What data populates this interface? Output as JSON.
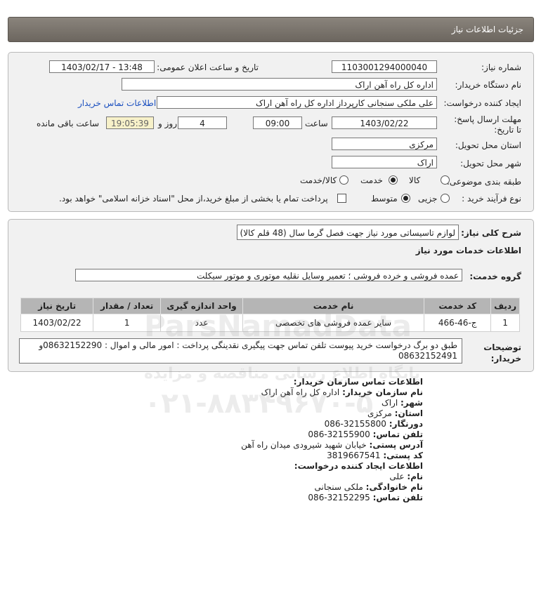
{
  "header": {
    "title": "جزئیات اطلاعات نیاز"
  },
  "details": {
    "need_number_label": "شماره نیاز:",
    "need_number": "1103001294000040",
    "announce_label": "تاریخ و ساعت اعلان عمومی:",
    "announce_value": "1403/02/17 - 13:48",
    "buyer_org_label": "نام دستگاه خریدار:",
    "buyer_org": "اداره کل راه آهن اراک",
    "creator_label": "ایجاد کننده درخواست:",
    "creator": "علی ملکی سنجانی کارپرداز اداره کل راه آهن اراک",
    "contact_link": "اطلاعات تماس خریدار",
    "deadline_label": "مهلت ارسال پاسخ: تا تاریخ:",
    "deadline_date": "1403/02/22",
    "time_label": "ساعت",
    "deadline_time": "09:00",
    "days_value": "4",
    "days_label": "روز و",
    "remaining_time": "19:05:39",
    "remaining_label": "ساعت باقی مانده",
    "province_label": "استان محل تحویل:",
    "province": "مرکزی",
    "city_label": "شهر محل تحویل:",
    "city": "اراک",
    "category_label": "طبقه بندی موضوعی:",
    "category_options": [
      "کالا",
      "خدمت",
      "کالا/خدمت"
    ],
    "category_selected": "خدمت",
    "process_label": "نوع فرآیند خرید :",
    "process_options": [
      "جزیی",
      "متوسط"
    ],
    "process_selected": "متوسط",
    "treasury_text": "پرداخت تمام یا بخشی از مبلغ خرید،از محل \"اسناد خزانه اسلامی\" خواهد بود."
  },
  "need": {
    "summary_label": "شرح کلی نیاز:",
    "summary": "لوازم تاسیساتی مورد نیاز جهت فصل گرما سال (48 قلم کالا)",
    "services_title": "اطلاعات خدمات مورد نیاز",
    "service_group_label": "گروه خدمت:",
    "service_group": "عمده فروشی و خرده فروشی ؛ تعمیر وسایل نقلیه موتوری و موتور سیکلت",
    "table": {
      "headers": [
        "ردیف",
        "کد خدمت",
        "نام خدمت",
        "واحد اندازه گیری",
        "تعداد / مقدار",
        "تاریخ نیاز"
      ],
      "rows": [
        [
          "1",
          "ج-46-466",
          "سایر عمده فروشی های تخصصی",
          "عدد",
          "1",
          "1403/02/22"
        ]
      ]
    },
    "notes_label": "توضیحات خریدار:",
    "notes_line1": "طبق دو برگ درخواست خرید پیوست تلفن تماس جهت پیگیری نقدینگی پرداخت : امور مالی و اموال : 08632152290و",
    "notes_line2": "08632152491"
  },
  "org_info": {
    "title": "اطلاعات تماس سازمان خریدار:",
    "org_name_label": "نام سازمان خریدار:",
    "org_name": "اداره کل راه آهن اراک",
    "city_label": "شهر:",
    "city": "اراک",
    "province_label": "استان:",
    "province": "مرکزی",
    "fax_label": "دورنگار:",
    "fax": "086-32155800",
    "phone_label": "تلفن تماس:",
    "phone": "086-32155900",
    "address_label": "آدرس پستی:",
    "address": "خیابان شهید شیرودی میدان راه آهن",
    "postal_label": "کد پستی:",
    "postal": "3819667541"
  },
  "creator_info": {
    "title": "اطلاعات ایجاد کننده درخواست:",
    "name_label": "نام:",
    "name": "علی",
    "family_label": "نام خانوادگی:",
    "family": "ملکی سنجانی",
    "phone_label": "تلفن تماس:",
    "phone": "086-32152295"
  },
  "watermark": {
    "brand": "ParsNamadData",
    "tagline": "پایگاه اطلاع رسانی مناقصه و مزایده",
    "phone": "۰۲۱-۸۸۳۴۹۶۷۰-۵"
  },
  "colors": {
    "header": "#756f68",
    "panel": "#f1f1f1",
    "link": "#1a4fbf",
    "table_header": "#b5b5b5"
  }
}
